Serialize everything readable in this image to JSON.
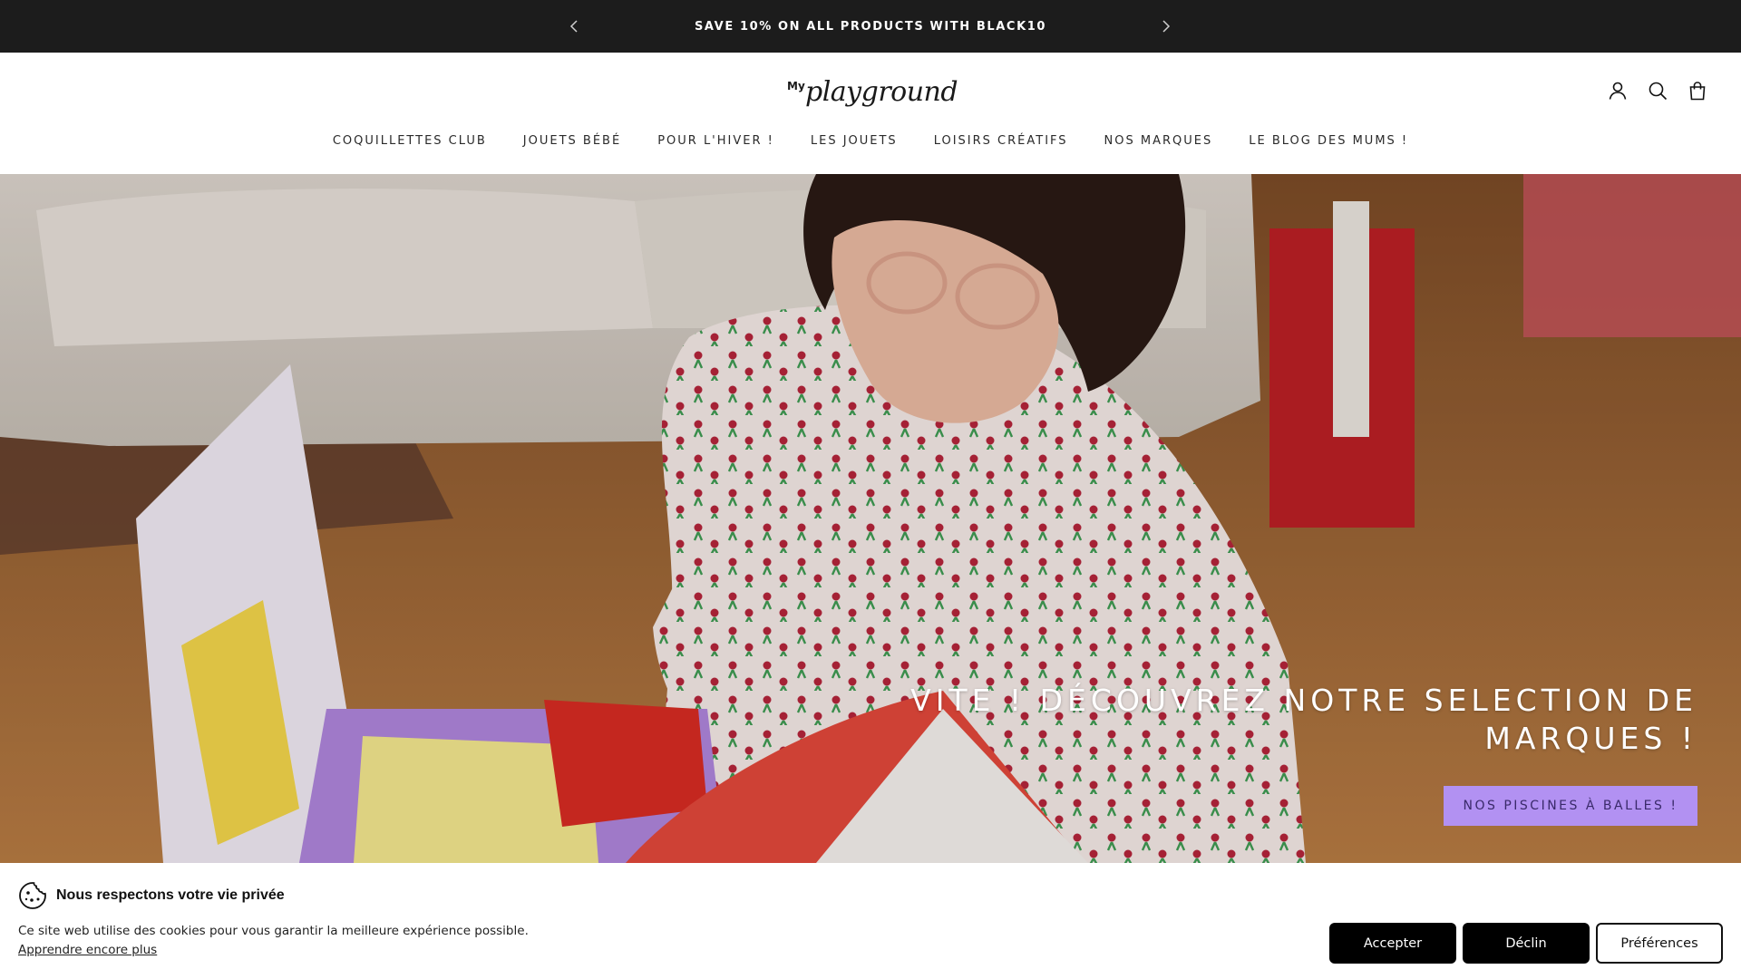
{
  "announcement": {
    "message": "SAVE 10% ON ALL PRODUCTS WITH BLACK10",
    "prev_icon": "chevron-left-icon",
    "next_icon": "chevron-right-icon"
  },
  "header": {
    "logo_prefix": "My",
    "logo_word": "playground",
    "icons": [
      "account-icon",
      "search-icon",
      "cart-icon"
    ]
  },
  "nav": {
    "items": [
      "COQUILLETTES CLUB",
      "JOUETS BÉBÉ",
      "POUR L'HIVER !",
      "LES JOUETS",
      "LOISIRS CRÉATIFS",
      "NOS MARQUES",
      "LE BLOG DES MUMS !"
    ]
  },
  "hero": {
    "heading_line1": "VITE ! DÉCOUVREZ NOTRE SELECTION DE",
    "heading_line2": "MARQUES !",
    "cta_label": "NOS PISCINES À BALLES !",
    "cta_color": "#b291f2"
  },
  "cookie": {
    "title": "Nous respectons votre vie privée",
    "text": "Ce site web utilise des cookies pour vous garantir la meilleure expérience possible.",
    "link": "Apprendre encore plus",
    "accept": "Accepter",
    "decline": "Déclin",
    "preferences": "Préférences",
    "icon": "cookie-icon"
  }
}
